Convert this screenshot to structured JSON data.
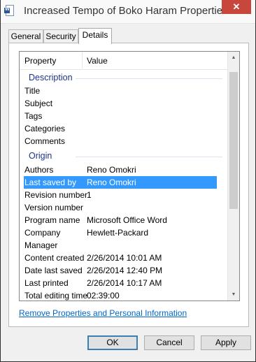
{
  "window": {
    "title": "Increased Tempo of Boko Haram Properties",
    "close_glyph": "✕",
    "icon": "word-document-icon"
  },
  "tabs": [
    {
      "label": "General"
    },
    {
      "label": "Security"
    },
    {
      "label": "Details"
    }
  ],
  "active_tab": "Details",
  "list": {
    "headers": {
      "property": "Property",
      "value": "Value"
    },
    "groups": {
      "description": "Description",
      "origin": "Origin"
    },
    "description_rows": [
      {
        "prop": "Title",
        "val": ""
      },
      {
        "prop": "Subject",
        "val": ""
      },
      {
        "prop": "Tags",
        "val": ""
      },
      {
        "prop": "Categories",
        "val": ""
      },
      {
        "prop": "Comments",
        "val": ""
      }
    ],
    "origin_rows": [
      {
        "prop": "Authors",
        "val": "Reno Omokri"
      },
      {
        "prop": "Last saved by",
        "val": "Reno Omokri"
      },
      {
        "prop": "Revision number",
        "val": "1"
      },
      {
        "prop": "Version number",
        "val": ""
      },
      {
        "prop": "Program name",
        "val": "Microsoft Office Word"
      },
      {
        "prop": "Company",
        "val": "Hewlett-Packard"
      },
      {
        "prop": "Manager",
        "val": ""
      },
      {
        "prop": "Content created",
        "val": "2/26/2014 10:01 AM"
      },
      {
        "prop": "Date last saved",
        "val": "2/26/2014 12:40 PM"
      },
      {
        "prop": "Last printed",
        "val": "2/26/2014 10:17 AM"
      },
      {
        "prop": "Total editing time",
        "val": "02:39:00"
      }
    ],
    "selected_row": "Last saved by"
  },
  "remove_link": "Remove Properties and Personal Information",
  "buttons": {
    "ok": "OK",
    "cancel": "Cancel",
    "apply": "Apply"
  },
  "colors": {
    "selection": "#3399ff",
    "group_title": "#1e3287",
    "link": "#0066cc",
    "close": "#c8473c"
  }
}
